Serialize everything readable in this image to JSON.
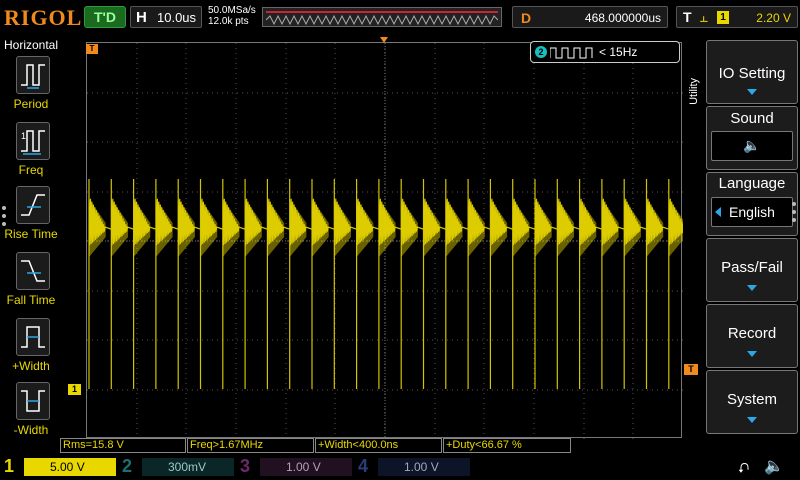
{
  "header": {
    "brand": "RIGOL",
    "trigger_status": "T'D",
    "horizontal_label": "H",
    "timebase": "10.0us",
    "sample_rate": "50.0MSa/s",
    "memory_points": "12.0k pts",
    "delay_label": "D",
    "delay_value": "468.000000us",
    "trigger_label": "T",
    "trigger_source": "1",
    "trigger_level": "2.20 V"
  },
  "left_menu": {
    "title": "Horizontal",
    "items": [
      {
        "label": "Period",
        "icon": "period-icon"
      },
      {
        "label": "Freq",
        "icon": "freq-icon"
      },
      {
        "label": "Rise Time",
        "icon": "rise-time-icon"
      },
      {
        "label": "Fall Time",
        "icon": "fall-time-icon"
      },
      {
        "label": "+Width",
        "icon": "pos-width-icon"
      },
      {
        "label": "-Width",
        "icon": "neg-width-icon"
      }
    ]
  },
  "screen": {
    "channel_marker": "1",
    "trigger_pos_marker": "T",
    "level_marker": "T",
    "freq_counter_channel": "2",
    "freq_counter_value": "< 15Hz"
  },
  "measurements": [
    {
      "text": "Rms=15.8 V"
    },
    {
      "text": "Freq>1.67MHz"
    },
    {
      "text": "+Width<400.0ns"
    },
    {
      "text": "+Duty<66.67 %"
    }
  ],
  "right_menu": {
    "vertical_label": "Utility",
    "io_setting": "IO Setting",
    "sound": "Sound",
    "sound_icon": "speaker-icon",
    "language": "Language",
    "language_value": "English",
    "pass_fail": "Pass/Fail",
    "record": "Record",
    "system": "System"
  },
  "channels": [
    {
      "num": "1",
      "scale": "5.00 V",
      "color": "#e8d800"
    },
    {
      "num": "2",
      "scale": "300mV",
      "color": "#17bfbf"
    },
    {
      "num": "3",
      "scale": "1.00 V",
      "color": "#c040c0"
    },
    {
      "num": "4",
      "scale": "1.00 V",
      "color": "#2a6ae8"
    }
  ],
  "colors": {
    "ch1": "#e8d800",
    "accent_orange": "#f08a1c",
    "menu_arrow": "#2aa8e8"
  }
}
